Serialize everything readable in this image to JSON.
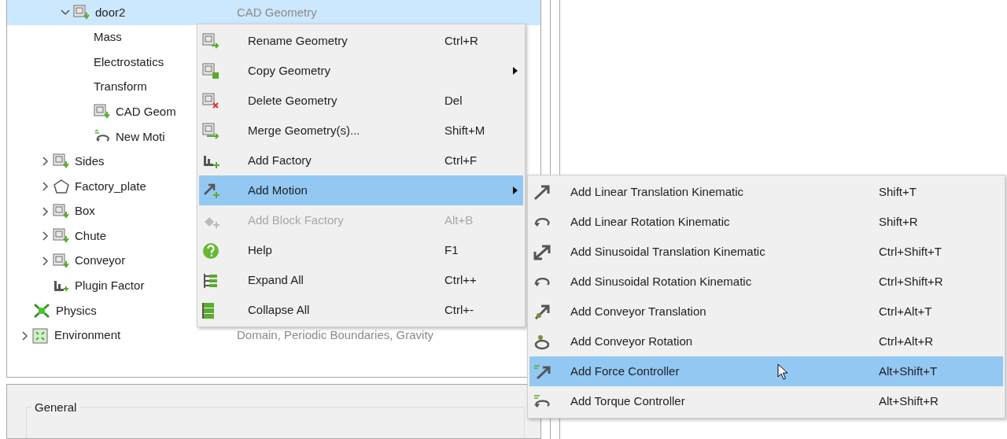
{
  "tree": {
    "items": [
      {
        "children": [
          {
            "children": [
              {
                "label": "door2",
                "detail": "CAD Geometry",
                "expanded": true,
                "selected": true,
                "children": [
                  {
                    "label": "Mass",
                    "selected": false
                  },
                  {
                    "label": "Electrostatics",
                    "selected": false
                  },
                  {
                    "label": "Transform",
                    "selected": false
                  },
                  {
                    "label": "CAD Geom",
                    "selected": false
                  },
                  {
                    "label": "New Moti",
                    "selected": false
                  }
                ]
              }
            ]
          },
          {
            "label": "Sides",
            "expanded": false,
            "selected": false
          },
          {
            "label": "Factory_plate",
            "expanded": false,
            "selected": false
          },
          {
            "label": "Box",
            "expanded": false,
            "selected": false
          },
          {
            "label": "Chute",
            "expanded": false,
            "selected": false
          },
          {
            "label": "Conveyor",
            "expanded": false,
            "selected": false
          },
          {
            "label": "Plugin Factor",
            "selected": false
          }
        ]
      },
      {
        "label": "Physics",
        "selected": false
      },
      {
        "label": "Environment",
        "detail": "Domain, Periodic Boundaries, Gravity",
        "expanded": false,
        "selected": false
      }
    ]
  },
  "context_menu": {
    "items": [
      {
        "label": "Rename Geometry",
        "shortcut": "Ctrl+R",
        "submenu": false,
        "selected": false,
        "disabled": false
      },
      {
        "label": "Copy Geometry",
        "submenu": true,
        "selected": false,
        "disabled": false
      },
      {
        "label": "Delete Geometry",
        "shortcut": "Del",
        "submenu": false,
        "selected": false,
        "disabled": false
      },
      {
        "label": "Merge Geometry(s)...",
        "shortcut": "Shift+M",
        "submenu": false,
        "selected": false,
        "disabled": false
      },
      {
        "label": "Add Factory",
        "shortcut": "Ctrl+F",
        "submenu": false,
        "selected": false,
        "disabled": false
      },
      {
        "label": "Add Motion",
        "submenu": true,
        "selected": true,
        "disabled": false
      },
      {
        "label": "Add Block Factory",
        "shortcut": "Alt+B",
        "submenu": false,
        "selected": false,
        "disabled": true
      },
      {
        "label": "Help",
        "shortcut": "F1",
        "submenu": false,
        "selected": false,
        "disabled": false
      },
      {
        "label": "Expand All",
        "shortcut": "Ctrl++",
        "submenu": false,
        "selected": false,
        "disabled": false
      },
      {
        "label": "Collapse All",
        "shortcut": "Ctrl+-",
        "submenu": false,
        "selected": false,
        "disabled": false
      }
    ]
  },
  "submenu": {
    "items": [
      {
        "label": "Add Linear Translation Kinematic",
        "shortcut": "Shift+T",
        "selected": false
      },
      {
        "label": "Add Linear Rotation Kinematic",
        "shortcut": "Shift+R",
        "selected": false
      },
      {
        "label": "Add Sinusoidal Translation Kinematic",
        "shortcut": "Ctrl+Shift+T",
        "selected": false
      },
      {
        "label": "Add Sinusoidal Rotation Kinematic",
        "shortcut": "Ctrl+Shift+R",
        "selected": false
      },
      {
        "label": "Add Conveyor Translation",
        "shortcut": "Ctrl+Alt+T",
        "selected": false
      },
      {
        "label": "Add Conveyor Rotation",
        "shortcut": "Ctrl+Alt+R",
        "selected": false
      },
      {
        "label": "Add Force Controller",
        "shortcut": "Alt+Shift+T",
        "selected": true
      },
      {
        "label": "Add Torque Controller",
        "shortcut": "Alt+Shift+R",
        "selected": false
      }
    ]
  },
  "properties": {
    "group_title": "General"
  }
}
